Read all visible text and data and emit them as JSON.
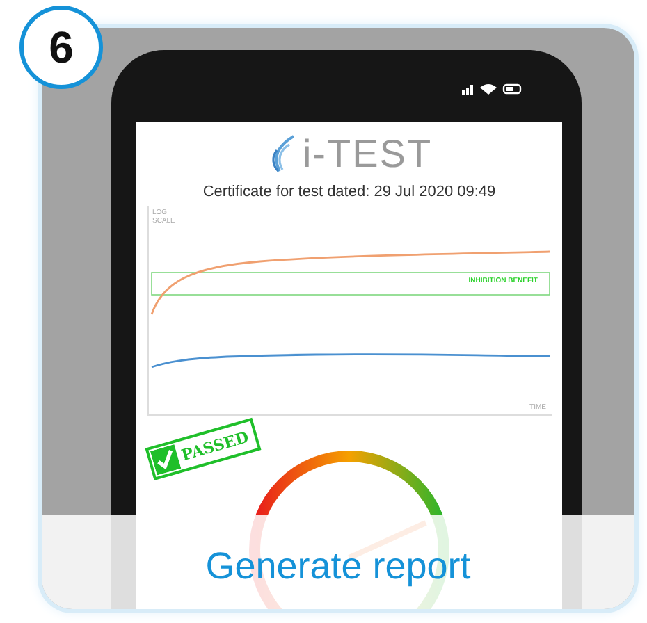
{
  "badge": "6",
  "phone": {
    "screen": {
      "logo_text": "i-TEST",
      "certificate": "Certificate for test dated: 29 Jul 2020  09:49",
      "chart": {
        "y_label": "LOG SCALE",
        "band_label": "INHIBITION BENEFIT",
        "x_label": "TIME"
      },
      "stamp": "PASSED"
    }
  },
  "action": {
    "label": "Generate report"
  }
}
